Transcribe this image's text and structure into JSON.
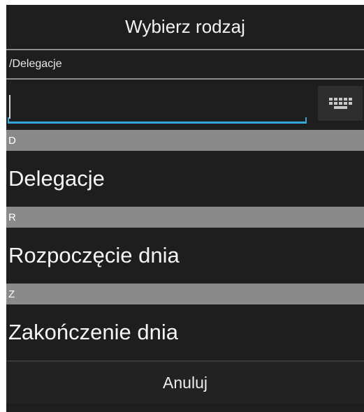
{
  "dialog": {
    "title": "Wybierz rodzaj",
    "path": "/Delegacje",
    "search": {
      "value": "",
      "placeholder": ""
    },
    "keyboard_button_icon": "keyboard-icon",
    "sections": [
      {
        "letter": "D",
        "items": [
          "Delegacje"
        ]
      },
      {
        "letter": "R",
        "items": [
          "Rozpoczęcie dnia"
        ]
      },
      {
        "letter": "Z",
        "items": [
          "Zakończenie dnia"
        ]
      }
    ],
    "cancel_label": "Anuluj"
  },
  "colors": {
    "dialog_background": "#1e1e1e",
    "section_header": "#8a8a8a",
    "input_underline": "#33a8d8"
  }
}
